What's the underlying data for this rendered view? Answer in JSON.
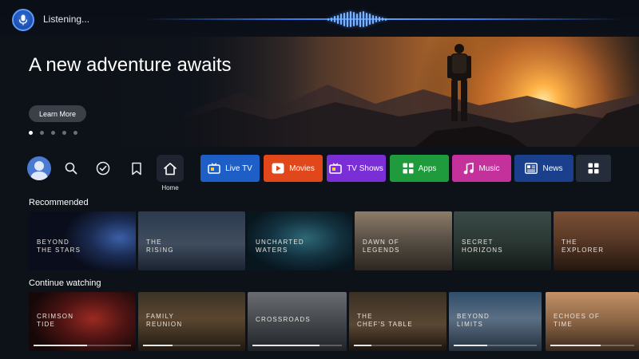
{
  "voice": {
    "status": "Listening..."
  },
  "hero": {
    "title": "A new adventure awaits",
    "cta": "Learn More",
    "slides": 5,
    "active_slide": 0
  },
  "nav": {
    "home_label": "Home",
    "tiles": [
      {
        "label": "Live TV",
        "icon": "tv-icon",
        "color": "#1d5fc7"
      },
      {
        "label": "Movies",
        "icon": "play-icon",
        "color": "#e0481c"
      },
      {
        "label": "TV Shows",
        "icon": "tv-icon",
        "color": "#7a2fd6"
      },
      {
        "label": "Apps",
        "icon": "grid-icon",
        "color": "#1f9a3c"
      },
      {
        "label": "Music",
        "icon": "music-note-icon",
        "color": "#c4319b"
      },
      {
        "label": "News",
        "icon": "newspaper-icon",
        "color": "#1a3f8c"
      },
      {
        "label": "",
        "icon": "grid-icon",
        "color": "#252c3a"
      }
    ]
  },
  "recommended": {
    "title": "Recommended",
    "items": [
      {
        "label": "BEYOND\nTHE STARS"
      },
      {
        "label": "THE\nRISING"
      },
      {
        "label": "UNCHARTED\nWATERS"
      },
      {
        "label": "DAWN OF\nLEGENDS"
      },
      {
        "label": "SECRET\nHORIZONS"
      },
      {
        "label": "THE\nEXPLORER"
      }
    ]
  },
  "continue_watching": {
    "title": "Continue watching",
    "items": [
      {
        "label": "CRIMSON\nTIDE",
        "progress": 0.55
      },
      {
        "label": "FAMILY\nREUNION",
        "progress": 0.3
      },
      {
        "label": "CROSSROADS",
        "progress": 0.75
      },
      {
        "label": "THE\nCHEF'S TABLE",
        "progress": 0.2
      },
      {
        "label": "BEYOND\nLIMITS",
        "progress": 0.4
      },
      {
        "label": "ECHOES OF\nTIME",
        "progress": 0.6
      }
    ]
  }
}
